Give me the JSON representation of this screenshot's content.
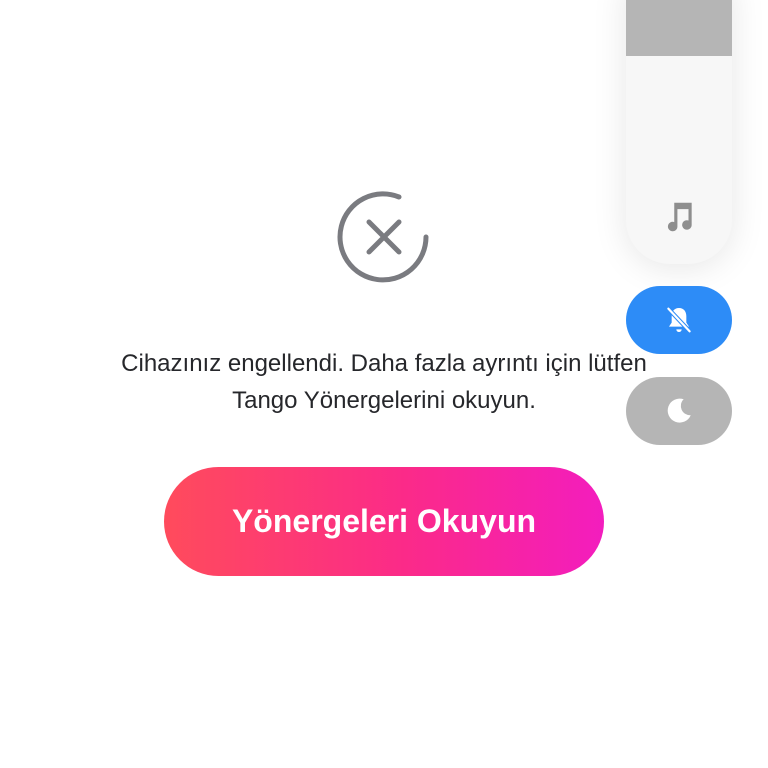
{
  "blocked_screen": {
    "icon": "blocked-x-circle-icon",
    "message_line1": "Cihazınız engellendi. Daha fazla ayrıntı için lütfen",
    "message_line2": "Tango Yönergelerini okuyun.",
    "button_label": "Yönergeleri Okuyun",
    "button_gradient": [
      "#ff4b5c",
      "#fb2a89",
      "#f31dbe"
    ]
  },
  "volume_overlay": {
    "level_fraction": 0.27,
    "fill_color": "#b5b5b5",
    "stream_icon": "music-note-icon",
    "mute_icon": "bell-slash-icon",
    "mute_active_color": "#2d8cf7",
    "dnd_icon": "moon-icon"
  }
}
